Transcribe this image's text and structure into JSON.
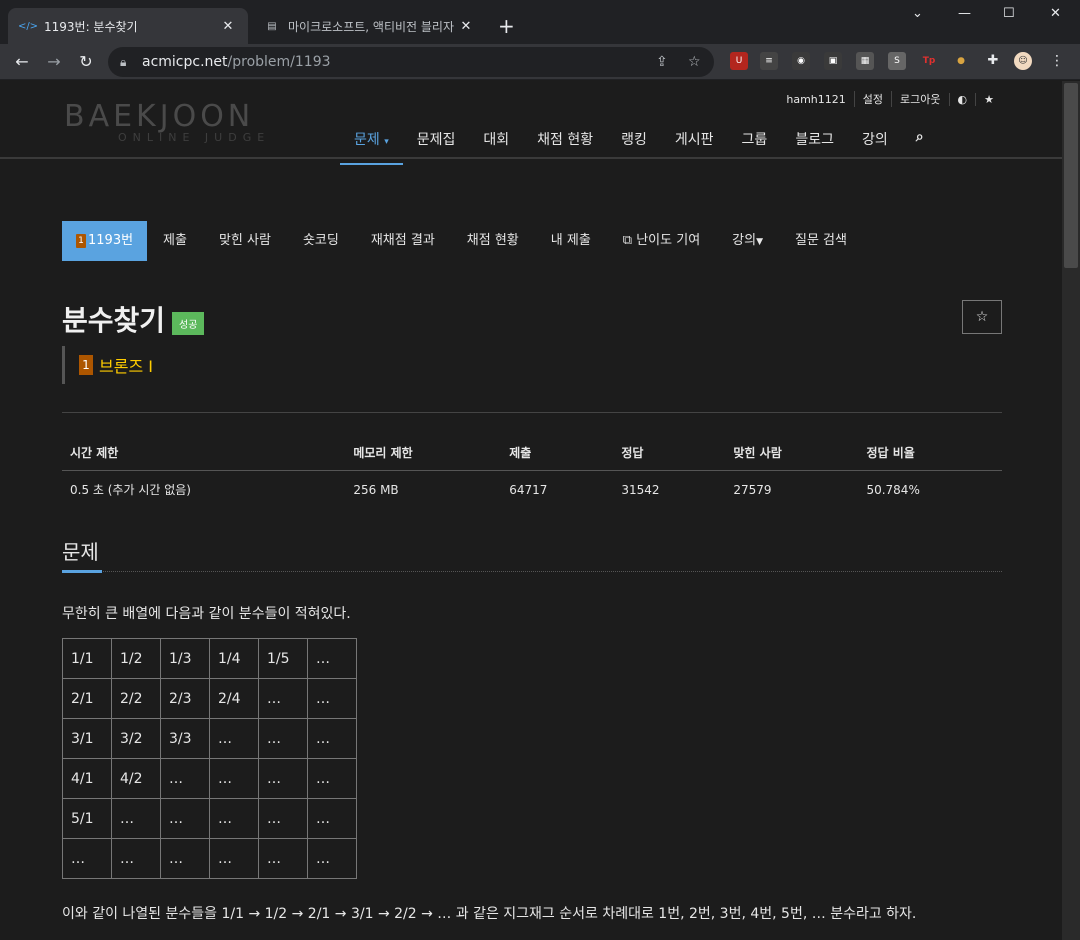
{
  "browser": {
    "tabs": [
      {
        "title": "1193번: 분수찾기",
        "active": true
      },
      {
        "title": "마이크로소프트, 액티비전 블리자",
        "active": false
      }
    ],
    "url_host": "acmicpc.net",
    "url_path": "/problem/1193"
  },
  "header": {
    "logo_main": "BAEKJOON",
    "logo_sub": "ONLINE JUDGE",
    "user_links": [
      "hamh1121",
      "설정",
      "로그아웃"
    ],
    "nav": [
      "문제",
      "문제집",
      "대회",
      "채점 현황",
      "랭킹",
      "게시판",
      "그룹",
      "블로그",
      "강의"
    ]
  },
  "subnav": {
    "items": [
      "1193번",
      "제출",
      "맞힌 사람",
      "숏코딩",
      "재채점 결과",
      "채점 현황",
      "내 제출",
      "난이도 기여",
      "강의",
      "질문 검색"
    ],
    "tier_number": "1"
  },
  "problem": {
    "title": "분수찾기",
    "status_badge": "성공",
    "tier_label": "브론즈 I",
    "tier_number": "1"
  },
  "info_table": {
    "headers": [
      "시간 제한",
      "메모리 제한",
      "제출",
      "정답",
      "맞힌 사람",
      "정답 비율"
    ],
    "values": [
      "0.5 초 (추가 시간 없음)",
      "256 MB",
      "64717",
      "31542",
      "27579",
      "50.784%"
    ]
  },
  "section": {
    "heading": "문제",
    "description": "무한히 큰 배열에 다음과 같이 분수들이 적혀있다.",
    "grid": [
      [
        "1/1",
        "1/2",
        "1/3",
        "1/4",
        "1/5",
        "…"
      ],
      [
        "2/1",
        "2/2",
        "2/3",
        "2/4",
        "…",
        "…"
      ],
      [
        "3/1",
        "3/2",
        "3/3",
        "…",
        "…",
        "…"
      ],
      [
        "4/1",
        "4/2",
        "…",
        "…",
        "…",
        "…"
      ],
      [
        "5/1",
        "…",
        "…",
        "…",
        "…",
        "…"
      ],
      [
        "…",
        "…",
        "…",
        "…",
        "…",
        "…"
      ]
    ],
    "description2": "이와 같이 나열된 분수들을 1/1 → 1/2 → 2/1 → 3/1 → 2/2 → … 과 같은 지그재그 순서로 차례대로 1번, 2번, 3번, 4번, 5번, … 분수라고 하자."
  },
  "colors": {
    "accent": "#5aa3e0",
    "success": "#5cb85c",
    "bronze": "#ad5600",
    "tier_text": "#ffcc00"
  }
}
